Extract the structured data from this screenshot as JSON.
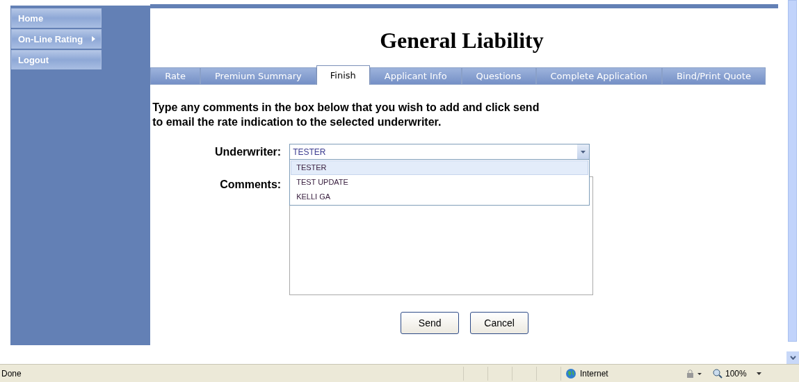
{
  "sidebar": {
    "items": [
      {
        "label": "Home",
        "has_submenu": false
      },
      {
        "label": "On-Line Rating",
        "has_submenu": true
      },
      {
        "label": "Logout",
        "has_submenu": false
      }
    ]
  },
  "title": "General Liability",
  "tabs": [
    {
      "label": "Rate",
      "selected": false
    },
    {
      "label": "Premium Summary",
      "selected": false
    },
    {
      "label": "Finish",
      "selected": true
    },
    {
      "label": "Applicant Info",
      "selected": false
    },
    {
      "label": "Questions",
      "selected": false
    },
    {
      "label": "Complete Application",
      "selected": false
    },
    {
      "label": "Bind/Print Quote",
      "selected": false
    }
  ],
  "instructions": [
    "Type any comments in the box below that you wish to add and click send",
    "to email the rate indication to the selected underwriter."
  ],
  "underwriter": {
    "label": "Underwriter:",
    "value": "TESTER",
    "expanded": true,
    "options": [
      {
        "label": "TESTER",
        "selected": true
      },
      {
        "label": "TEST UPDATE",
        "selected": false
      },
      {
        "label": "KELLI GA",
        "selected": false
      }
    ]
  },
  "comments": {
    "label": "Comments:"
  },
  "buttons": [
    "Send",
    "Cancel"
  ],
  "status_bar": {
    "status": "Done",
    "zone": "Internet",
    "zoom": "100%"
  }
}
